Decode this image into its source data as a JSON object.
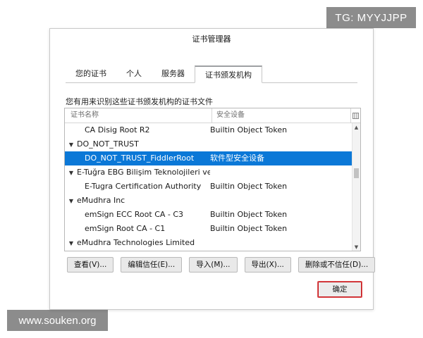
{
  "watermarks": {
    "tg": "TG: MYYJJPP",
    "site": "www.souken.org"
  },
  "dialog": {
    "title": "证书管理器",
    "tabs": [
      {
        "label": "您的证书",
        "active": false
      },
      {
        "label": "个人",
        "active": false
      },
      {
        "label": "服务器",
        "active": false
      },
      {
        "label": "证书颁发机构",
        "active": true
      }
    ],
    "description": "您有用来识别这些证书颁发机构的证书文件",
    "columns": {
      "name": "证书名称",
      "device": "安全设备"
    },
    "rows": [
      {
        "type": "child",
        "name": "CA Disig Root R2",
        "device": "Builtin Object Token",
        "selected": false
      },
      {
        "type": "group",
        "name": "DO_NOT_TRUST",
        "device": "",
        "selected": false
      },
      {
        "type": "child",
        "name": "DO_NOT_TRUST_FiddlerRoot",
        "device": "软件型安全设备",
        "selected": true
      },
      {
        "type": "group",
        "name": "E-Tuğra EBG Bilişim Teknolojileri ve Hi...",
        "device": "",
        "selected": false
      },
      {
        "type": "child",
        "name": "E-Tugra Certification Authority",
        "device": "Builtin Object Token",
        "selected": false
      },
      {
        "type": "group",
        "name": "eMudhra Inc",
        "device": "",
        "selected": false
      },
      {
        "type": "child",
        "name": "emSign ECC Root CA - C3",
        "device": "Builtin Object Token",
        "selected": false
      },
      {
        "type": "child",
        "name": "emSign Root CA - C1",
        "device": "Builtin Object Token",
        "selected": false
      },
      {
        "type": "group",
        "name": "eMudhra Technologies Limited",
        "device": "",
        "selected": false
      }
    ],
    "buttons": {
      "view": "查看(V)...",
      "edit_trust": "编辑信任(E)...",
      "import": "导入(M)...",
      "export": "导出(X)...",
      "delete_distrust": "删除或不信任(D)..."
    },
    "ok": "确定"
  }
}
